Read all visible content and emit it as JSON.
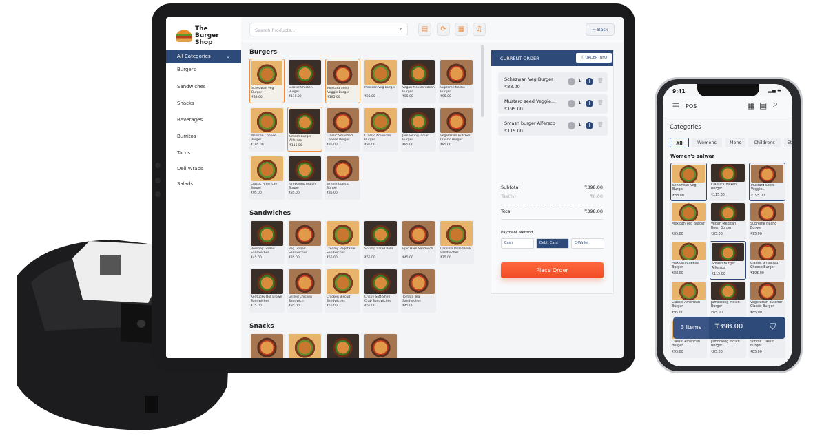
{
  "brand": {
    "name": "The Burger Shop",
    "accent": "#2e4a78",
    "highlight": "#f08a3a",
    "cta": "#f14a24"
  },
  "tablet": {
    "sidebar": {
      "selected": "All Categories",
      "items": [
        "Burgers",
        "Sandwiches",
        "Snacks",
        "Beverages",
        "Burritos",
        "Tacos",
        "Deli Wraps",
        "Salads"
      ]
    },
    "search": {
      "placeholder": "Search Products..."
    },
    "toolbar": {
      "icons": [
        "receipt-icon",
        "refresh-icon",
        "calculator-icon",
        "bell-icon"
      ],
      "back_label": "← Back"
    },
    "sections": [
      {
        "title": "Burgers",
        "products": [
          {
            "name": "Schezwan Veg Burger",
            "price": "₹88.00",
            "selected": true
          },
          {
            "name": "Classic Chicken Burger",
            "price": "₹110.00"
          },
          {
            "name": "Mustard Seed Veggie Burger Combo",
            "price": "₹195.00",
            "selected": true
          },
          {
            "name": "Mexican Veg Burger",
            "price": "₹95.00"
          },
          {
            "name": "Vegan Mexican Bean Burger",
            "price": "₹85.00"
          },
          {
            "name": "Supreme Nacho Burger",
            "price": "₹95.00"
          },
          {
            "name": "Mexican Cheese Burger",
            "price": "₹105.00"
          },
          {
            "name": "Smash Burger Alfersco",
            "price": "₹115.00",
            "selected": true
          },
          {
            "name": "Classic Smashed Cheese Burger",
            "price": "₹85.00"
          },
          {
            "name": "Classic American Burger",
            "price": "₹95.00"
          },
          {
            "name": "Jumboking Indian Burger",
            "price": "₹85.00"
          },
          {
            "name": "Vegetarian Butcher Classic Burger",
            "price": "₹85.00"
          },
          {
            "name": "Classic American Burger",
            "price": "₹95.00"
          },
          {
            "name": "Jumboking Indian Burger",
            "price": "₹85.00"
          },
          {
            "name": "Simple Classic Burger",
            "price": "₹85.00"
          }
        ]
      },
      {
        "title": "Sandwiches",
        "products": [
          {
            "name": "Bombay Grilled Sandwiches",
            "price": "₹45.00"
          },
          {
            "name": "Veg Grilled Sandwiches",
            "price": "₹35.00"
          },
          {
            "name": "Creamy Vegetable Sandwiches",
            "price": "₹55.00"
          },
          {
            "name": "Shrimp Salad Rolls",
            "price": "₹65.00"
          },
          {
            "name": "Epic Ham Sandwich",
            "price": "₹45.00"
          },
          {
            "name": "Carolina Pulled Pork Sandwiches",
            "price": "₹75.00"
          },
          {
            "name": "Kentucky Hot Brown Sandwiches",
            "price": "₹75.00"
          },
          {
            "name": "Grilled Chicken Sandwich",
            "price": "₹85.00"
          },
          {
            "name": "Chicken Biscuit Sandwiches",
            "price": "₹55.00"
          },
          {
            "name": "Crispy Soft-Shell Crab Sandwiches",
            "price": "₹65.00"
          },
          {
            "name": "Tomato Tea Sandwiches",
            "price": "₹45.00"
          }
        ]
      },
      {
        "title": "Snacks",
        "products": [
          {
            "name": "",
            "price": ""
          },
          {
            "name": "",
            "price": ""
          },
          {
            "name": "",
            "price": ""
          },
          {
            "name": "",
            "price": ""
          }
        ]
      }
    ],
    "order": {
      "title": "CURRENT ORDER",
      "info_label": "ORDER INFO",
      "items": [
        {
          "name": "Schezwan Veg Burger",
          "price": "₹88.00",
          "qty": "1"
        },
        {
          "name": "Mustard seed Veggie...",
          "price": "₹195.00",
          "qty": "1"
        },
        {
          "name": "Smash burger Alfersco",
          "price": "₹115.00",
          "qty": "1"
        }
      ],
      "subtotal_label": "Subtotal",
      "subtotal": "₹398.00",
      "tax_label": "Tax(%)",
      "tax": "₹0.00",
      "total_label": "Total",
      "total": "₹398.00",
      "payment_label": "Payment Method",
      "payment_methods": [
        "Cash",
        "Debit Card",
        "E-Wallet"
      ],
      "payment_selected": "Debit Card",
      "place_label": "Place Order"
    }
  },
  "phone": {
    "time": "9:41",
    "title": "POS",
    "categories_label": "Categories",
    "chips": [
      "All",
      "Womens",
      "Mens",
      "Childrens",
      "Eth"
    ],
    "section": "Women's salwar",
    "products": [
      {
        "name": "Schezwan Veg Burger",
        "price": "₹88.00",
        "selected": true
      },
      {
        "name": "Classic Chicken Burger",
        "price": "₹115.00"
      },
      {
        "name": "Mustard Seed Veggie...",
        "price": "₹195.00",
        "selected": true
      },
      {
        "name": "Mexican Veg Burger",
        "price": "₹85.00"
      },
      {
        "name": "Vegan Mexican Been Burger",
        "price": "₹85.00"
      },
      {
        "name": "Supreme Nacho Burger",
        "price": "₹95.00"
      },
      {
        "name": "Mexican Cheese Burger",
        "price": "₹88.00"
      },
      {
        "name": "Smash Burger Alfersco",
        "price": "₹115.00",
        "selected": true
      },
      {
        "name": "Classic Smashed Cheese Burger",
        "price": "₹195.00"
      },
      {
        "name": "Classic American Burger",
        "price": "₹95.00"
      },
      {
        "name": "Jumboking Indian Burger",
        "price": "₹85.00"
      },
      {
        "name": "Vegetarian Butcher Classic Burger",
        "price": "₹85.00"
      },
      {
        "name": "Classic American Burger",
        "price": "₹95.00"
      },
      {
        "name": "Jumboking Indian Burger",
        "price": "₹85.00"
      },
      {
        "name": "Simple Classic Burger",
        "price": "₹85.00"
      }
    ],
    "cart": {
      "count_label": "3 Items",
      "total": "₹398.00"
    }
  }
}
